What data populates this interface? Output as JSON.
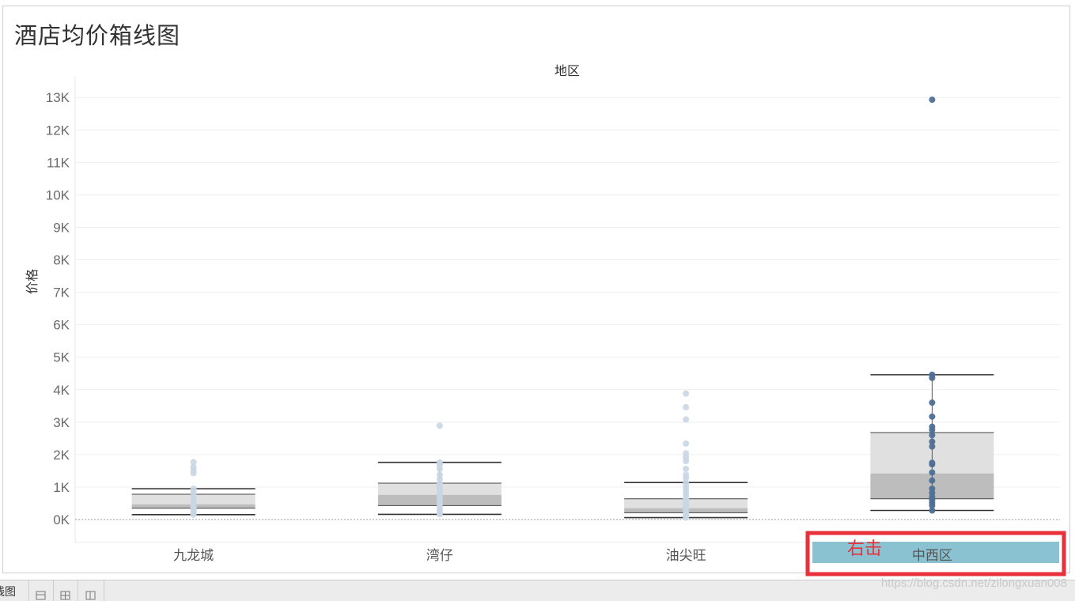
{
  "title": "酒店均价箱线图",
  "header_label": "地区",
  "annotation_text": "右击",
  "watermark": "https://blog.csdn.net/zilongxuan008",
  "colors": {
    "selected_band": "#8ac2d1",
    "annotation_box": "#e8313a",
    "point_dim": "#c9d6e3",
    "point_active": "#4e6f96",
    "box_upper": "#e0e0e0",
    "box_lower": "#bdbdbd"
  },
  "bottom_tabs": [
    {
      "label": "线图",
      "icon": "sheet-tab"
    },
    {
      "label": "",
      "icon": "new-worksheet-icon"
    },
    {
      "label": "",
      "icon": "new-dashboard-icon"
    },
    {
      "label": "",
      "icon": "new-story-icon"
    }
  ],
  "chart_data": {
    "type": "boxplot",
    "xlabel": "地区",
    "ylabel": "价格",
    "ylim": [
      -700,
      13600
    ],
    "ticks": [
      {
        "value": 0,
        "label": "0K"
      },
      {
        "value": 1000,
        "label": "1K"
      },
      {
        "value": 2000,
        "label": "2K"
      },
      {
        "value": 3000,
        "label": "3K"
      },
      {
        "value": 4000,
        "label": "4K"
      },
      {
        "value": 5000,
        "label": "5K"
      },
      {
        "value": 6000,
        "label": "6K"
      },
      {
        "value": 7000,
        "label": "7K"
      },
      {
        "value": 8000,
        "label": "8K"
      },
      {
        "value": 9000,
        "label": "9K"
      },
      {
        "value": 10000,
        "label": "10K"
      },
      {
        "value": 11000,
        "label": "11K"
      },
      {
        "value": 12000,
        "label": "12K"
      },
      {
        "value": 13000,
        "label": "13K"
      }
    ],
    "categories": [
      "九龙城",
      "湾仔",
      "油尖旺",
      "中西区"
    ],
    "selected_category": "中西区",
    "boxes": [
      {
        "category": "九龙城",
        "whisker_low": 150,
        "q1": 350,
        "median": 470,
        "q3": 780,
        "whisker_high": 950,
        "points": [
          150,
          200,
          260,
          320,
          380,
          430,
          480,
          560,
          650,
          750,
          860,
          950,
          1430,
          1520,
          1620,
          1770
        ]
      },
      {
        "category": "湾仔",
        "whisker_low": 160,
        "q1": 430,
        "median": 760,
        "q3": 1120,
        "whisker_high": 1760,
        "points": [
          160,
          220,
          300,
          380,
          450,
          530,
          620,
          700,
          780,
          860,
          940,
          1030,
          1120,
          1250,
          1380,
          1560,
          1680,
          1760,
          2890
        ]
      },
      {
        "category": "油尖旺",
        "whisker_low": 60,
        "q1": 210,
        "median": 350,
        "q3": 640,
        "whisker_high": 1140,
        "points": [
          60,
          120,
          180,
          240,
          300,
          360,
          430,
          500,
          570,
          640,
          720,
          820,
          920,
          1030,
          1140,
          1280,
          1380,
          1560,
          1800,
          1920,
          2040,
          2340,
          3080,
          3460,
          3880
        ]
      },
      {
        "category": "中西区",
        "whisker_low": 280,
        "q1": 640,
        "median": 1420,
        "q3": 2680,
        "whisker_high": 4460,
        "points": [
          280,
          430,
          520,
          600,
          700,
          820,
          950,
          1200,
          1450,
          1700,
          1750,
          2250,
          2400,
          2600,
          2760,
          2860,
          3170,
          3600,
          4360,
          4460,
          12930
        ]
      }
    ]
  }
}
